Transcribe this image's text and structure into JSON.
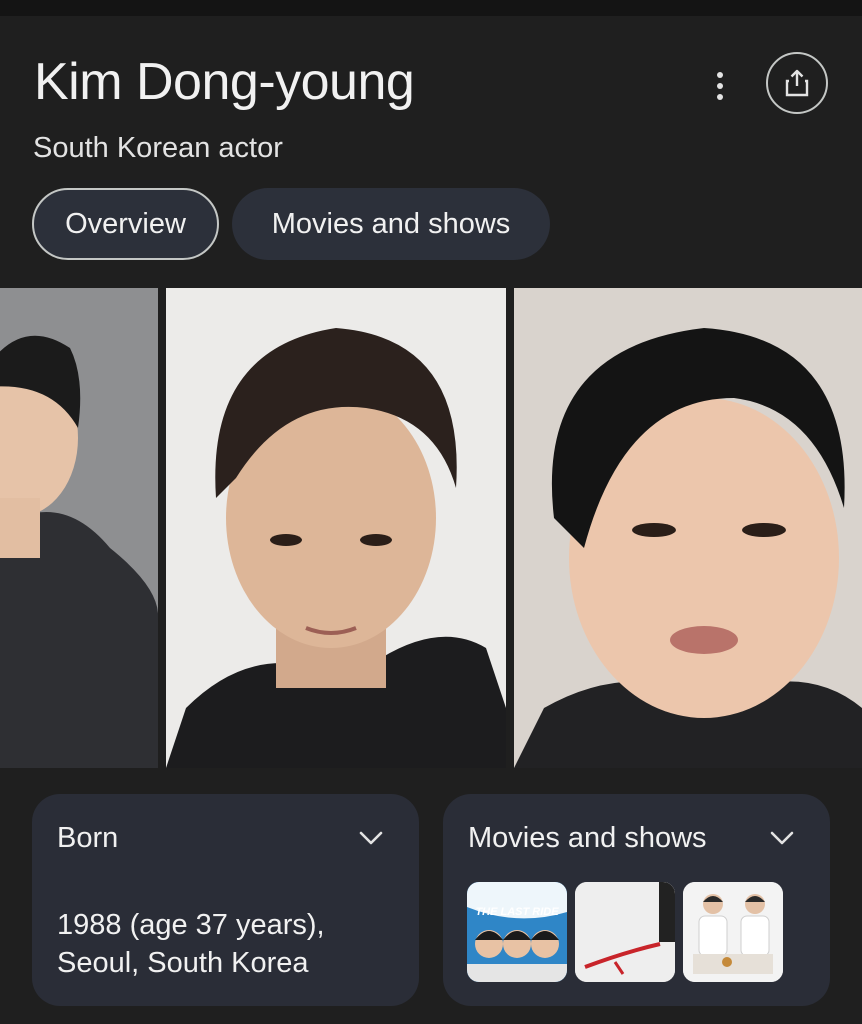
{
  "header": {
    "title": "Kim Dong-young",
    "subtitle": "South Korean actor"
  },
  "actions": {
    "more_icon": "more-vert-icon",
    "share_icon": "share-icon"
  },
  "tabs": [
    {
      "label": "Overview",
      "active": true
    },
    {
      "label": "Movies and shows",
      "active": false
    }
  ],
  "images": [
    {
      "subject": "portrait-photo-1"
    },
    {
      "subject": "portrait-photo-2"
    },
    {
      "subject": "portrait-photo-3"
    }
  ],
  "cards": {
    "born": {
      "label": "Born",
      "value_line1": "1988 (age 37 years),",
      "value_line2": "Seoul, South Korea"
    },
    "movies": {
      "label": "Movies and shows",
      "thumbnails": [
        {
          "caption": "THE LAST RIDE"
        },
        {
          "caption": ""
        },
        {
          "caption": ""
        }
      ]
    }
  },
  "colors": {
    "background": "#1f1f1f",
    "chip_background": "#2c303a",
    "card_background": "#2a2d37",
    "text": "#f1f1f1"
  }
}
